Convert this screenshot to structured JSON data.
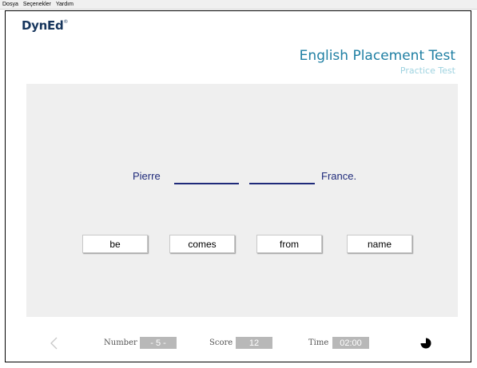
{
  "menu": {
    "items": [
      "Dosya",
      "Seçenekler",
      "Yardım"
    ]
  },
  "app": {
    "logo": "DynEd",
    "logo_mark": "®"
  },
  "header": {
    "title": "English Placement Test",
    "subtitle": "Practice Test"
  },
  "question": {
    "before": "Pierre",
    "after": "France.",
    "blank_count": 2
  },
  "choices": [
    "be",
    "comes",
    "from",
    "name"
  ],
  "status": {
    "number_label": "Number",
    "number_value": "- 5 -",
    "score_label": "Score",
    "score_value": "12",
    "time_label": "Time",
    "time_value": "02:00"
  },
  "colors": {
    "title": "#1f7fa3",
    "subtitle": "#9fd3e0",
    "sentence": "#1f2a7a",
    "panel": "#efefef",
    "value_box": "#b8b8b8"
  },
  "icons": {
    "prev": "chevron-left-icon",
    "timer": "timer-icon"
  }
}
